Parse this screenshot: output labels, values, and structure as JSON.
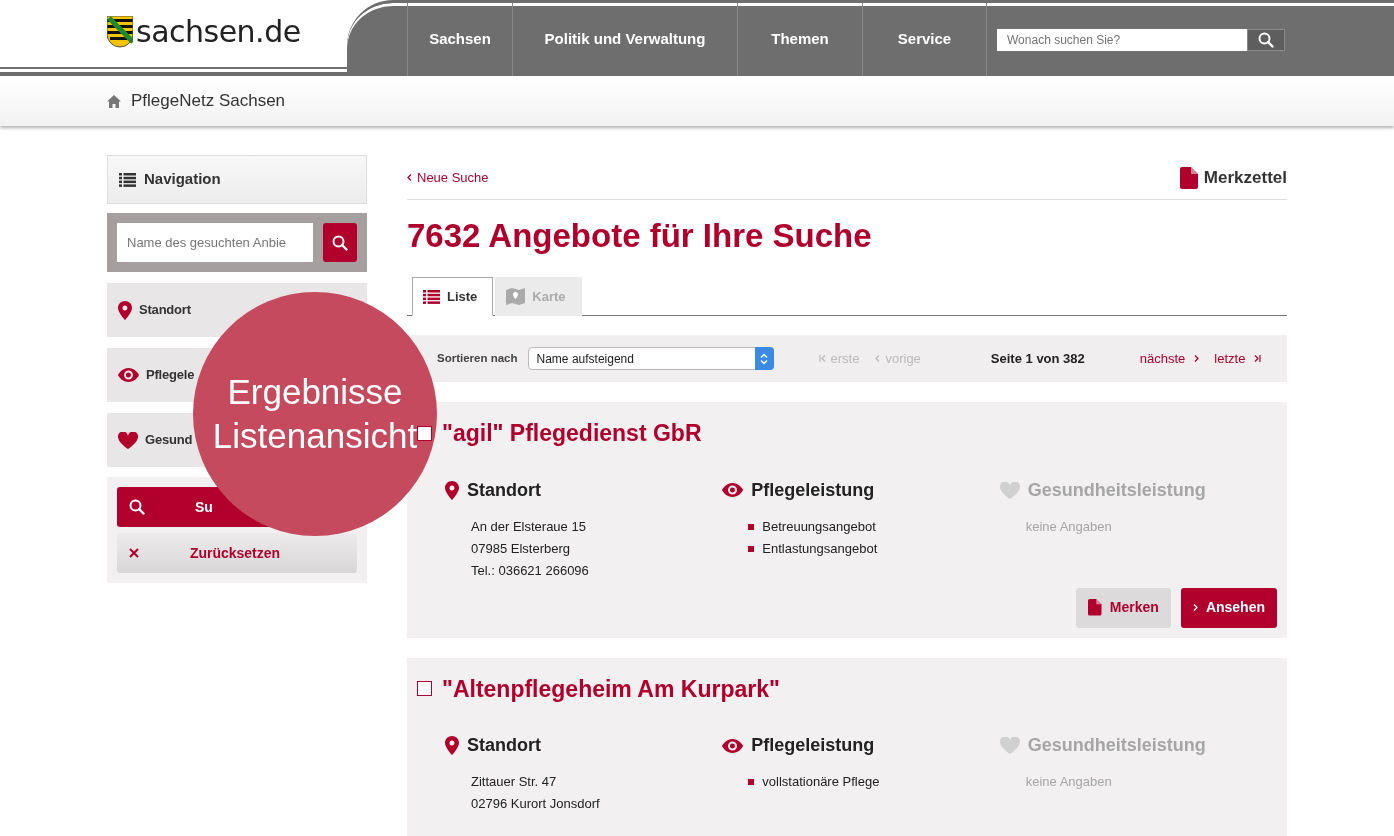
{
  "header": {
    "logo": "sachsen.de",
    "nav": [
      {
        "label": "Sachsen"
      },
      {
        "label": "Politik und Verwaltung"
      },
      {
        "label": "Themen"
      },
      {
        "label": "Service"
      }
    ],
    "search": {
      "placeholder": "Wonach suchen Sie?"
    }
  },
  "breadcrumb": {
    "label": "PflegeNetz Sachsen"
  },
  "sidebar": {
    "title": "Navigation",
    "search": {
      "placeholder": "Name des gesuchten Anbie"
    },
    "filters": [
      {
        "label": "Standort",
        "kind": "location"
      },
      {
        "label": "Pflegele",
        "kind": "care"
      },
      {
        "label": "Gesund",
        "kind": "health"
      }
    ],
    "buttons": [
      {
        "label": "Su",
        "kind": "search"
      },
      {
        "label": "Zurücksetzen",
        "kind": "reset"
      }
    ]
  },
  "main": {
    "back_link": "Neue Suche",
    "bookmark": "Merkzettel",
    "heading": "7632 Angebote für Ihre Suche",
    "tabs": [
      {
        "label": "Liste",
        "kind": "list",
        "selected": true
      },
      {
        "label": "Karte",
        "kind": "map",
        "selected": false
      }
    ],
    "sort": {
      "label": "Sortieren nach",
      "value": "Name aufsteigend"
    },
    "pager": [
      {
        "label": "erste",
        "kind": "first",
        "disabled": true
      },
      {
        "label": "vorige",
        "kind": "prev",
        "disabled": true
      },
      {
        "label": "Seite 1 von 382",
        "kind": "info"
      },
      {
        "label": "nächste",
        "kind": "next",
        "disabled": false
      },
      {
        "label": "letzte",
        "kind": "last",
        "disabled": false
      }
    ]
  },
  "results": [
    {
      "title": "\"agil\" Pflegedienst GbR",
      "checked": false,
      "sections": [
        {
          "kind": "location",
          "heading": "Standort",
          "disabled": false,
          "lines": [
            "An der Elsteraue 15",
            "07985 Elsterberg",
            "Tel.: 036621 266096"
          ]
        },
        {
          "kind": "care",
          "heading": "Pflegeleistung",
          "disabled": false,
          "items": [
            "Betreuungsangebot",
            "Entlastungsangebot"
          ]
        },
        {
          "kind": "health",
          "heading": "Gesundheitsleistung",
          "disabled": true,
          "lines": [
            "keine Angaben"
          ]
        }
      ],
      "actions": [
        {
          "label": "Merken",
          "kind": "bookmark"
        },
        {
          "label": "Ansehen",
          "kind": "view"
        }
      ]
    },
    {
      "title": "\"Altenpflegeheim Am Kurpark\"",
      "checked": false,
      "sections": [
        {
          "kind": "location",
          "heading": "Standort",
          "disabled": false,
          "lines": [
            "Zittauer Str. 47",
            "02796 Kurort Jonsdorf"
          ]
        },
        {
          "kind": "care",
          "heading": "Pflegeleistung",
          "disabled": false,
          "items": [
            "vollstationäre Pflege"
          ]
        },
        {
          "kind": "health",
          "heading": "Gesundheitsleistung",
          "disabled": true,
          "lines": [
            "keine Angaben"
          ]
        }
      ]
    }
  ],
  "overlay": {
    "caption": "Ergebnisse Listenansicht"
  }
}
